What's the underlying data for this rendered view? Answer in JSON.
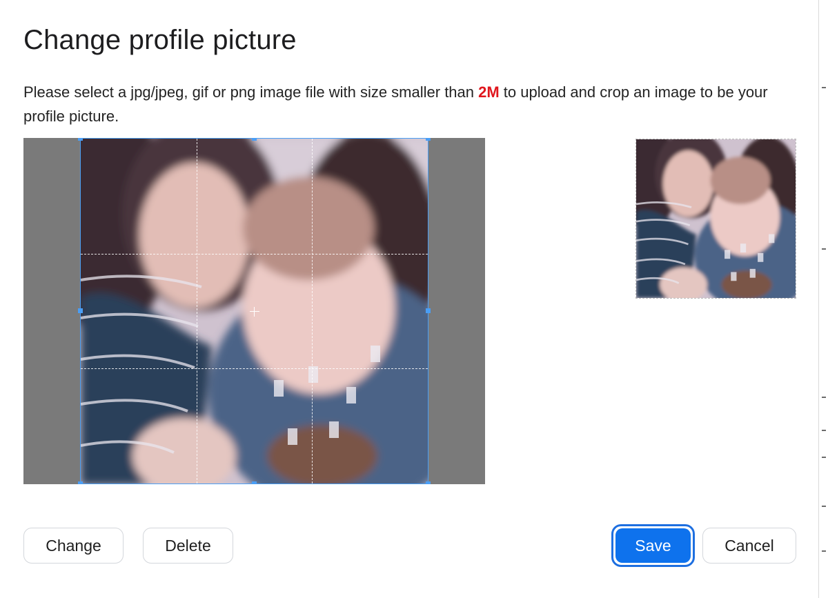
{
  "dialog": {
    "title": "Change profile picture",
    "description_before": "Please select a jpg/jpeg, gif or png image file with size smaller than ",
    "size_limit": "2M",
    "description_after": " to upload and crop an image to be your profile picture."
  },
  "cropper": {
    "image": "profile-photo",
    "preview_image": "profile-photo-preview"
  },
  "buttons": {
    "change": "Change",
    "delete": "Delete",
    "save": "Save",
    "cancel": "Cancel"
  },
  "colors": {
    "accent": "#0e72ed",
    "size_limit": "#e0161d",
    "crop_border": "#4a9ef5",
    "backdrop": "#7a7a7a"
  }
}
